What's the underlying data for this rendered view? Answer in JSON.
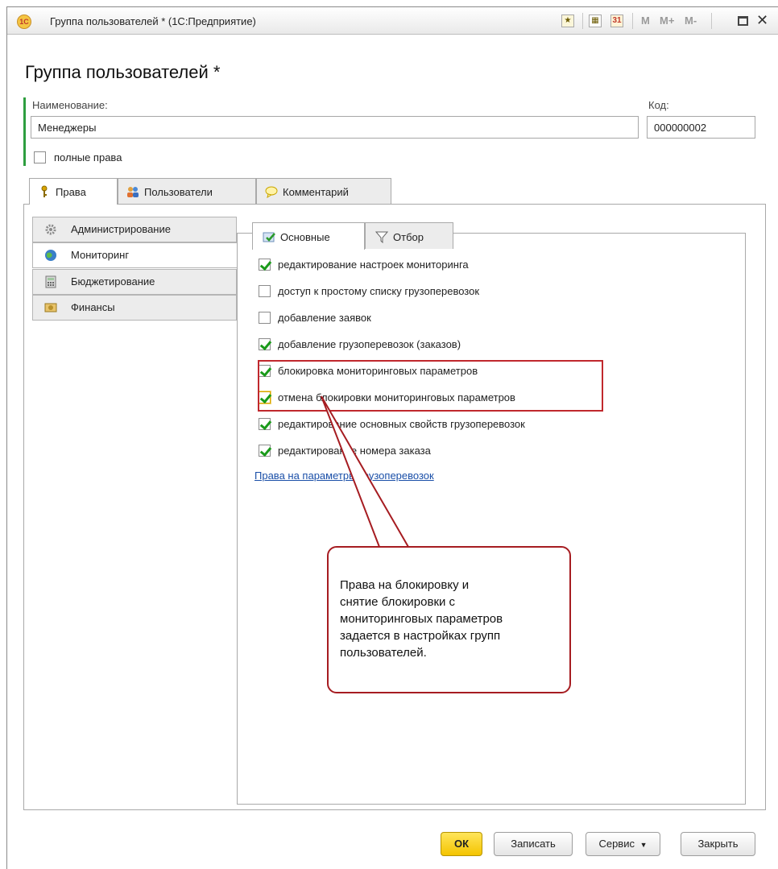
{
  "window": {
    "title": "Группа пользователей * (1С:Предприятие)",
    "logo_text": "1С",
    "toolbar": {
      "m_label": "M",
      "mplus_label": "M+",
      "mminus_label": "M-",
      "calendar_label": "31"
    }
  },
  "form": {
    "heading": "Группа пользователей *",
    "name_label": "Наименование:",
    "name_value": "Менеджеры",
    "code_label": "Код:",
    "code_value": "000000002",
    "full_rights_label": "полные права",
    "full_rights_checked": false
  },
  "tabs": [
    {
      "label": "Права",
      "active": true
    },
    {
      "label": "Пользователи",
      "active": false
    },
    {
      "label": "Комментарий",
      "active": false
    }
  ],
  "sections": [
    {
      "label": "Администрирование",
      "icon": "gear-icon",
      "active": false
    },
    {
      "label": "Мониторинг",
      "icon": "globe-icon",
      "active": true
    },
    {
      "label": "Бюджетирование",
      "icon": "calculator-icon",
      "active": false
    },
    {
      "label": "Финансы",
      "icon": "money-icon",
      "active": false
    }
  ],
  "inner_tabs": [
    {
      "label": "Основные",
      "icon": "checklist-icon",
      "active": true
    },
    {
      "label": "Отбор",
      "icon": "filter-icon",
      "active": false
    }
  ],
  "permissions": [
    {
      "label": "редактирование настроек мониторинга",
      "checked": true
    },
    {
      "label": "доступ к простому списку грузоперевозок",
      "checked": false
    },
    {
      "label": "добавление заявок",
      "checked": false
    },
    {
      "label": "добавление грузоперевозок (заказов)",
      "checked": true
    },
    {
      "label": "блокировка мониторинговых параметров",
      "checked": true
    },
    {
      "label": "отмена блокировки мониторинговых параметров",
      "checked": true
    },
    {
      "label": "редактирование основных свойств грузоперевозок",
      "checked": true
    },
    {
      "label": "редактирование номера заказа",
      "checked": true
    }
  ],
  "link": "Права на параметры грузоперевозок",
  "callout": {
    "lines": [
      "Права на блокировку и",
      "снятие блокировки с",
      "мониторинговых параметров",
      "задается в настройках групп",
      "пользователей."
    ],
    "border_color": "#a61c21"
  },
  "footer": {
    "ok_label": "ОК",
    "save_label": "Записать",
    "service_label": "Сервис",
    "close_label": "Закрыть"
  },
  "colors": {
    "accent_green": "#2e9e3f",
    "highlight_red": "#c0282d",
    "link_blue": "#1a4fa8",
    "ok_yellow": "#f4c400"
  }
}
